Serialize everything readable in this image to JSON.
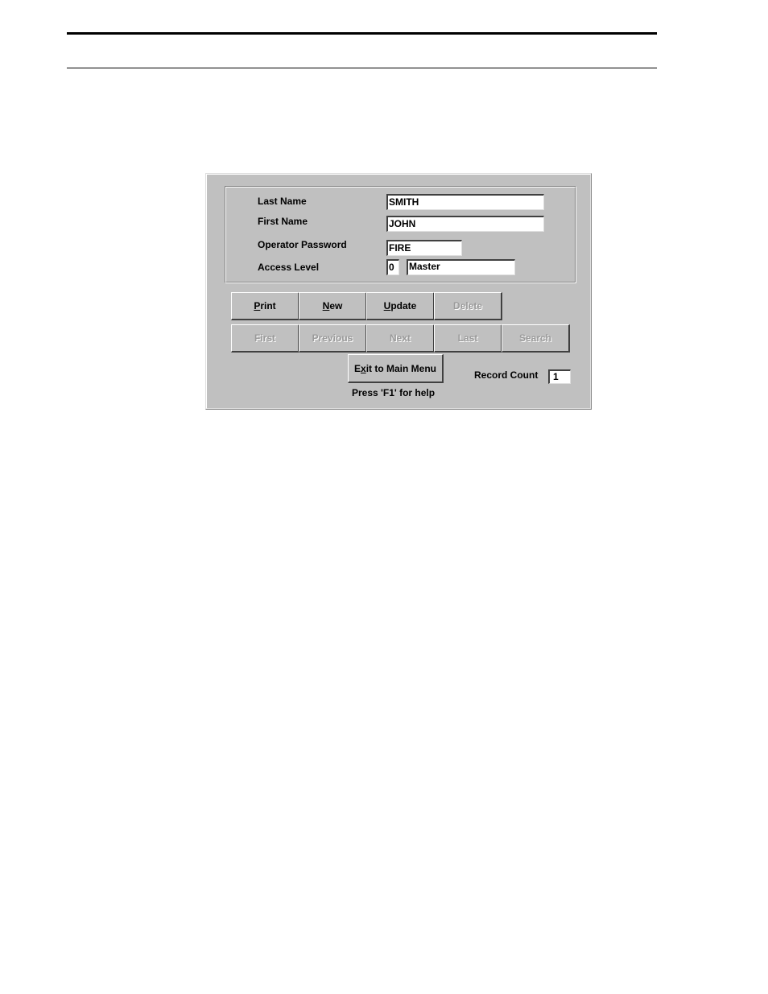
{
  "page": {
    "rules": [
      "thick-top-rule",
      "thin-top-rule"
    ]
  },
  "form": {
    "fields": {
      "last_name": {
        "label": "Last Name",
        "value": "SMITH"
      },
      "first_name": {
        "label": "First Name",
        "value": "JOHN"
      },
      "operator_password": {
        "label": "Operator Password",
        "value": "FIRE"
      },
      "access_level": {
        "label": "Access Level",
        "code": "0",
        "name": "Master"
      }
    },
    "buttons_row1": [
      {
        "mnemonic": "P",
        "rest": "rint",
        "label": "Print",
        "enabled": true
      },
      {
        "mnemonic": "N",
        "rest": "ew",
        "label": "New",
        "enabled": true
      },
      {
        "mnemonic": "U",
        "rest": "pdate",
        "label": "Update",
        "enabled": true
      },
      {
        "label": "Delete",
        "enabled": false
      }
    ],
    "buttons_row2": [
      {
        "label": "First",
        "enabled": false
      },
      {
        "label": "Previous",
        "enabled": false
      },
      {
        "label": "Next",
        "enabled": false
      },
      {
        "label": "Last",
        "enabled": false
      },
      {
        "label": "Search",
        "enabled": false
      }
    ],
    "exit_button": {
      "pre": "E",
      "mnemonic": "x",
      "rest": "it to Main Menu",
      "label": "Exit to Main Menu"
    },
    "help_text": "Press 'F1' for help",
    "record_count": {
      "label": "Record Count",
      "value": "1"
    }
  }
}
